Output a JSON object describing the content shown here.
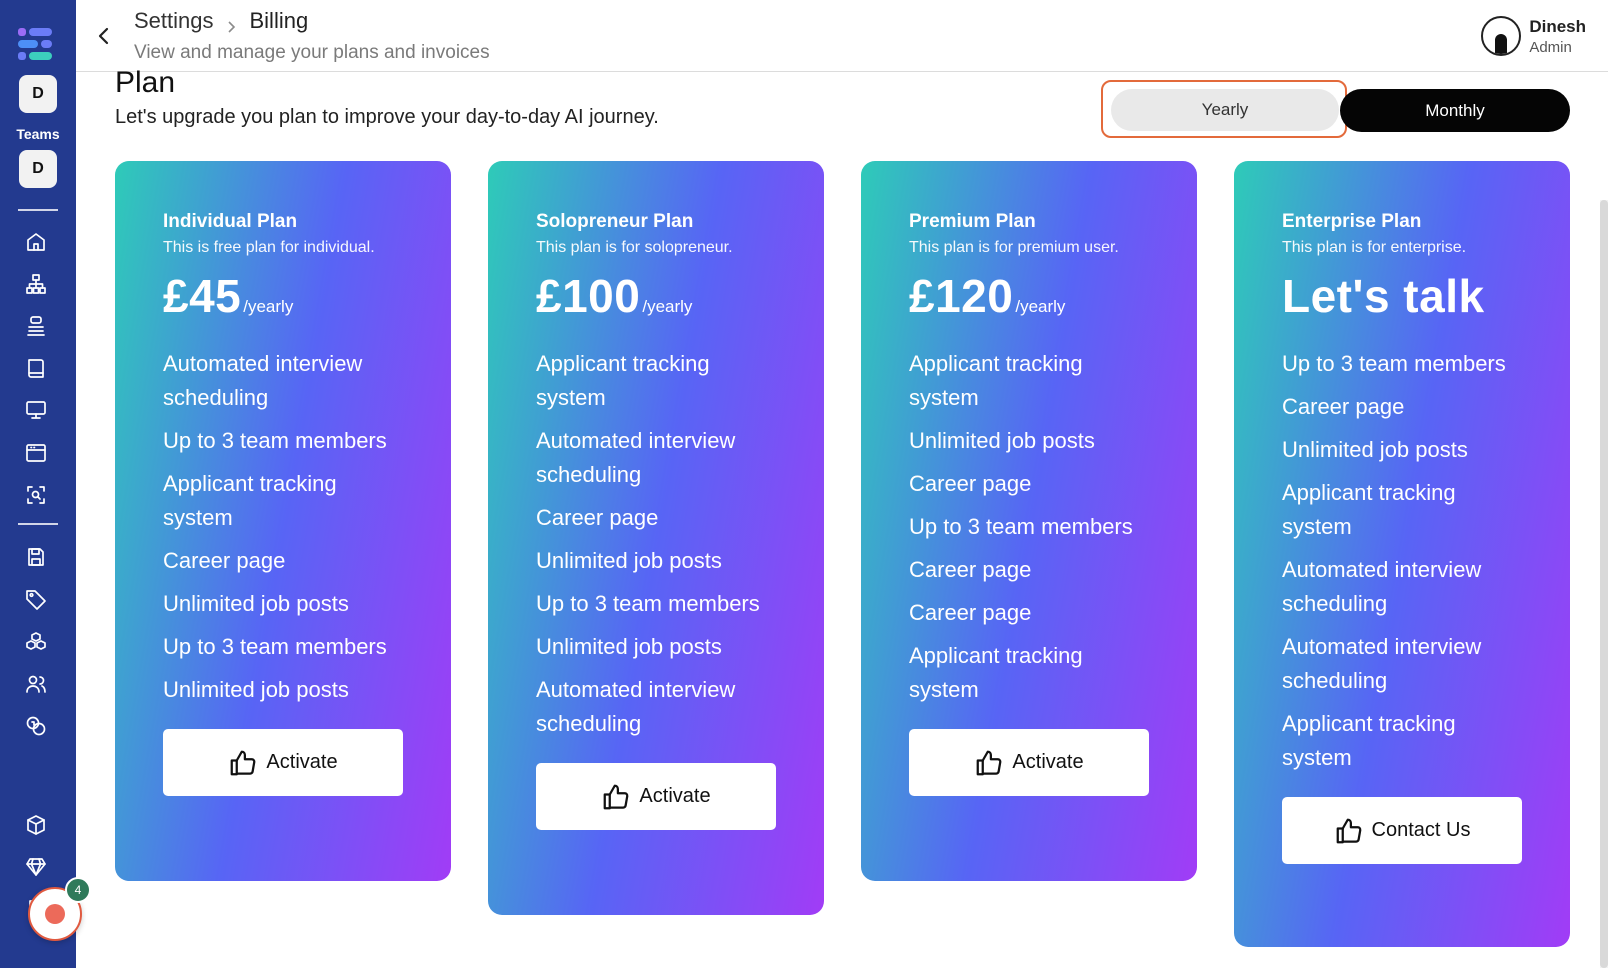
{
  "sidebar": {
    "workspace_initial": "D",
    "teams_label": "Teams",
    "team_initial": "D",
    "recorder_count": "4",
    "icons": [
      "home-icon",
      "org-chart-icon",
      "stack-icon",
      "book-icon",
      "monitor-icon",
      "browser-window-icon",
      "scan-search-icon",
      "save-icon",
      "tag-icon",
      "cubes-icon",
      "users-icon",
      "coins-icon",
      "package-icon",
      "diamond-icon",
      "document-icon"
    ]
  },
  "header": {
    "breadcrumb_root": "Settings",
    "breadcrumb_current": "Billing",
    "subtitle": "View and manage your plans and invoices",
    "user_name": "Dinesh",
    "user_role": "Admin"
  },
  "plan_section": {
    "title": "Plan",
    "description": "Let's upgrade you plan to improve your day-to-day AI journey.",
    "toggle": {
      "yearly": "Yearly",
      "monthly": "Monthly",
      "selected": "Yearly"
    }
  },
  "plans": [
    {
      "name": "Individual Plan",
      "tagline": "This is free plan for individual.",
      "price": "£45",
      "period": "/yearly",
      "features": [
        "Automated interview scheduling",
        "Up to 3 team members",
        "Applicant tracking system",
        "Career page",
        "Unlimited job posts",
        "Up to 3 team members",
        "Unlimited job posts"
      ],
      "button": "Activate"
    },
    {
      "name": "Solopreneur Plan",
      "tagline": "This plan is for solopreneur.",
      "price": "£100",
      "period": "/yearly",
      "features": [
        "Applicant tracking system",
        "Automated interview scheduling",
        "Career page",
        "Unlimited job posts",
        "Up to 3 team members",
        "Unlimited job posts",
        "Automated interview scheduling"
      ],
      "button": "Activate"
    },
    {
      "name": "Premium Plan",
      "tagline": "This plan is for premium user.",
      "price": "£120",
      "period": "/yearly",
      "features": [
        "Applicant tracking system",
        "Unlimited job posts",
        "Career page",
        "Up to 3 team members",
        "Career page",
        "Career page",
        "Applicant tracking system"
      ],
      "button": "Activate"
    },
    {
      "name": "Enterprise Plan",
      "tagline": "This plan is for enterprise.",
      "price": "Let's talk",
      "period": "",
      "features": [
        "Up to 3 team members",
        "Career page",
        "Unlimited job posts",
        "Applicant tracking system",
        "Automated interview scheduling",
        "Automated interview scheduling",
        "Applicant tracking system"
      ],
      "button": "Contact Us"
    }
  ],
  "colors": {
    "sidebar": "#233a8f",
    "card_gradient_start": "#2ecbb8",
    "card_gradient_mid": "#5765f5",
    "card_gradient_end": "#a13cf6",
    "toggle_focus": "#e36a3b"
  }
}
